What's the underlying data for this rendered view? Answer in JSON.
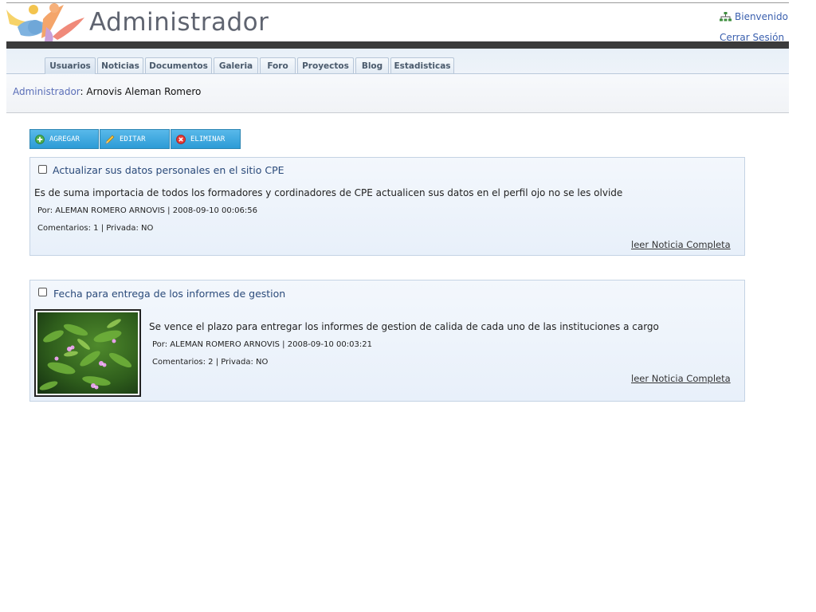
{
  "header": {
    "app_title": "Administrador",
    "welcome_label": "Bienvenido",
    "logout_label": "Cerrar Sesión"
  },
  "nav": {
    "tabs": [
      {
        "label": "Usuarios",
        "active": true
      },
      {
        "label": "Noticias",
        "active": false
      },
      {
        "label": "Documentos",
        "active": false
      },
      {
        "label": "Galeria",
        "active": false
      },
      {
        "label": "Foro",
        "active": false
      },
      {
        "label": "Proyectos",
        "active": false
      },
      {
        "label": "Blog",
        "active": false
      },
      {
        "label": "Estadisticas",
        "active": false
      }
    ]
  },
  "breadcrumb": {
    "role_link": "Administrador",
    "separator": ":",
    "user_name": "Arnovis Aleman Romero"
  },
  "toolbar": {
    "add_label": "AGREGAR",
    "edit_label": "EDITAR",
    "delete_label": "ELIMINAR"
  },
  "news": [
    {
      "title": "Actualizar sus datos personales en el sitio CPE",
      "body": "Es de suma importacia de todos los formadores y cordinadores de CPE actualicen sus datos en el perfil ojo no se les olvide",
      "author_line": "Por: ALEMAN ROMERO ARNOVIS | 2008-09-10 00:06:56",
      "stats_line": "Comentarios: 1 | Privada: NO",
      "read_more": "leer Noticia Completa",
      "has_image": false
    },
    {
      "title": "Fecha para entrega de los informes de gestion",
      "body": "Se vence el plazo para entregar los informes de gestion de calida de cada uno de las instituciones a cargo",
      "author_line": "Por: ALEMAN ROMERO ARNOVIS | 2008-09-10 00:03:21",
      "stats_line": "Comentarios: 2 | Privada: NO",
      "read_more": "leer Noticia Completa",
      "has_image": true
    }
  ],
  "colors": {
    "title": "#5f6470",
    "link": "#3a5fae",
    "dark_bar": "#3b3b3b",
    "button": "#2c9bd6",
    "card_border": "#c4d3e4",
    "news_title": "#2a4a7a"
  }
}
